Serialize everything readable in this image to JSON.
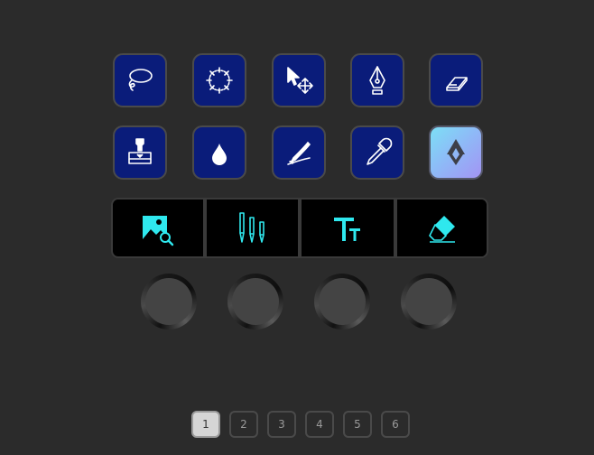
{
  "colors": {
    "background": "#2b2b2b",
    "key_fill": "#0a1c7a",
    "icon_white": "#ffffff",
    "strip_icon": "#2fe8ee",
    "page_active": "#d5d5d5"
  },
  "keys_row1": [
    {
      "icon": "lasso-icon"
    },
    {
      "icon": "magic-lasso-icon"
    },
    {
      "icon": "move-selection-icon"
    },
    {
      "icon": "pen-nib-icon"
    },
    {
      "icon": "eraser-icon"
    }
  ],
  "keys_row2": [
    {
      "icon": "stamp-icon"
    },
    {
      "icon": "water-drop-icon"
    },
    {
      "icon": "smudge-icon"
    },
    {
      "icon": "eyedropper-icon"
    },
    {
      "icon": "app-logo-icon"
    }
  ],
  "strip": [
    {
      "icon": "image-search-icon"
    },
    {
      "icon": "brushes-icon"
    },
    {
      "icon": "text-size-icon"
    },
    {
      "icon": "eraser-icon"
    }
  ],
  "dials_count": 4,
  "pages": {
    "items": [
      "1",
      "2",
      "3",
      "4",
      "5",
      "6"
    ],
    "active": "1"
  }
}
